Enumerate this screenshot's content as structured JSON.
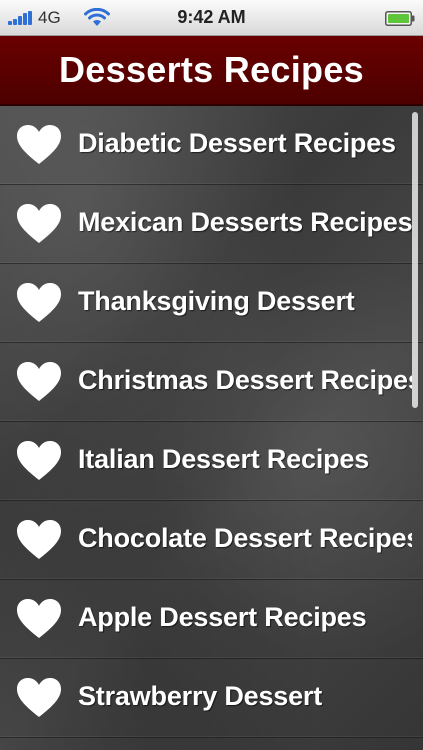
{
  "status_bar": {
    "carrier": "4G",
    "time": "9:42 AM",
    "icons": [
      "signal-icon",
      "wifi-icon",
      "battery-icon"
    ]
  },
  "header": {
    "title": "Desserts Recipes"
  },
  "list": {
    "item_icon": "heart-icon",
    "items": [
      {
        "label": "Diabetic Dessert Recipes"
      },
      {
        "label": "Mexican Desserts Recipes"
      },
      {
        "label": "Thanksgiving Dessert"
      },
      {
        "label": "Christmas Dessert Recipes"
      },
      {
        "label": "Italian Dessert Recipes"
      },
      {
        "label": "Chocolate Dessert Recipes"
      },
      {
        "label": "Apple Dessert Recipes"
      },
      {
        "label": "Strawberry Dessert"
      }
    ]
  },
  "colors": {
    "header_bg": "#5c0000",
    "status_bar_bg": "#e8e8e8",
    "list_bg": "#404040",
    "text": "#ffffff",
    "signal": "#2f6fd6",
    "battery": "#5ec43a"
  }
}
